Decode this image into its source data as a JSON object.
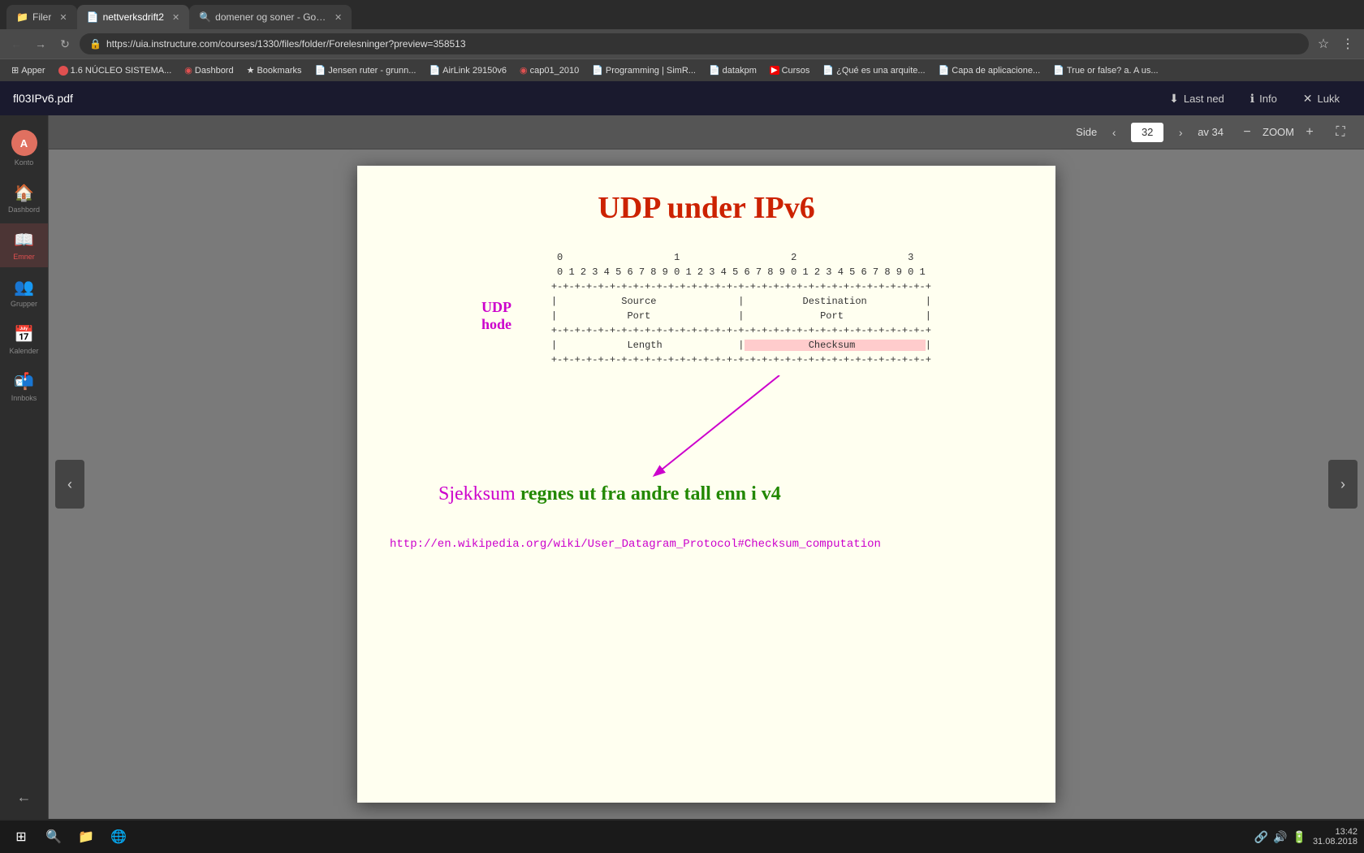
{
  "browser": {
    "tabs": [
      {
        "id": "tab-filer",
        "title": "Filer",
        "icon": "📁",
        "active": false
      },
      {
        "id": "tab-nettverksdrift",
        "title": "nettverksdrift2",
        "icon": "📄",
        "active": true
      },
      {
        "id": "tab-domener",
        "title": "domener og soner - Goo...",
        "icon": "🔍",
        "active": false
      }
    ],
    "address": "https://uia.instructure.com/courses/1330/files/folder/Forelesninger?preview=358513",
    "secure_label": "Sikker",
    "bookmarks": [
      {
        "label": "Apper"
      },
      {
        "label": "1.6 NÚCLEO SISTEMA..."
      },
      {
        "label": "Dashbord"
      },
      {
        "label": "Bookmarks"
      },
      {
        "label": "Jensen ruter - grunn..."
      },
      {
        "label": "AirLink 29150v6"
      },
      {
        "label": "cap01_2010"
      },
      {
        "label": "Programming | SimR..."
      },
      {
        "label": "datakpm"
      },
      {
        "label": "Cursos"
      },
      {
        "label": "¿Qué es una arquite..."
      },
      {
        "label": "Capa de aplicacione..."
      },
      {
        "label": "True or false? a. A us..."
      }
    ]
  },
  "app": {
    "file_title": "fl03IPv6.pdf",
    "actions": {
      "download": "Last ned",
      "info": "Info",
      "close": "Lukk"
    }
  },
  "pdf_toolbar": {
    "page_label": "Side",
    "current_page": "32",
    "total_pages": "av 34",
    "zoom_label": "ZOOM"
  },
  "slide": {
    "title": "UDP under IPv6",
    "udp_label_line1": "UDP",
    "udp_label_line2": "hode",
    "diagram_pre": "     0                   1                   2                   3\n     0 1 2 3 4 5 6 7 8 9 0 1 2 3 4 5 6 7 8 9 0 1 2 3 4 5 6 7 8 9 0 1\n    +-+-+-+-+-+-+-+-+-+-+-+-+-+-+-+-+-+-+-+-+-+-+-+-+-+-+-+-+-+-+-+-+\n    |           Source              |          Destination          |\n    |            Port               |             Port              |\n    +-+-+-+-+-+-+-+-+-+-+-+-+-+-+-+-+-+-+-+-+-+-+-+-+-+-+-+-+-+-+-+-+\n    |            Length             |           Checksum            |\n    +-+-+-+-+-+-+-+-+-+-+-+-+-+-+-+-+-+-+-+-+-+-+-+-+-+-+-+-+-+-+-+-+",
    "annotation_pink": "Sjekksum",
    "annotation_rest": " regnes ut fra andre tall enn i v4",
    "wiki_link": "http://en.wikipedia.org/wiki/User_Datagram_Protocol#Checksum_computation"
  },
  "taskbar": {
    "time": "13:42",
    "date": "31.08.2018",
    "icons": [
      "⊞",
      "🔍",
      "📁",
      "🌐"
    ]
  },
  "sidebar": {
    "items": [
      {
        "id": "account",
        "icon": "👤",
        "label": "Konto",
        "active": false
      },
      {
        "id": "dashboard",
        "icon": "🏠",
        "label": "Dashbord",
        "active": false
      },
      {
        "id": "subjects",
        "icon": "📖",
        "label": "Emner",
        "active": true
      },
      {
        "id": "groups",
        "icon": "👥",
        "label": "Grupper",
        "active": false
      },
      {
        "id": "calendar",
        "icon": "📅",
        "label": "Kalender",
        "active": false
      },
      {
        "id": "inbox",
        "icon": "📬",
        "label": "Innboks",
        "active": false
      }
    ],
    "nav_bottom": "←"
  }
}
